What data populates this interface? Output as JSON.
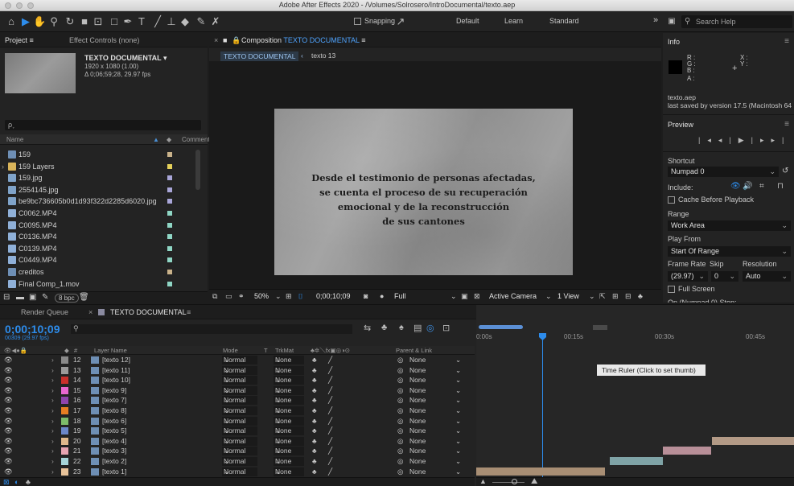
{
  "window": {
    "title": "Adobe After Effects 2020 - /Volumes/Solrosero/IntroDocumental/texto.aep"
  },
  "toolbar": {
    "snapping_label": "Snapping",
    "workspaces": [
      "Default",
      "Learn",
      "Standard"
    ],
    "more_label": "»",
    "search_placeholder": "Search Help"
  },
  "project": {
    "tab_project": "Project ≡",
    "tab_effects": "Effect Controls (none)",
    "comp_name": "TEXTO DOCUMENTAL ▾",
    "comp_res": "1920 x 1080 (1.00)",
    "comp_dur": "Δ 0;06;59;28, 29.97 fps",
    "search_glyph": "ρ˯",
    "col_name": "Name",
    "col_comment": "Comment",
    "items": [
      {
        "name": "159",
        "icon_color": "#6e8fb5",
        "label_color": "#c9b28a"
      },
      {
        "name": "159 Layers",
        "icon_color": "#d9b45a",
        "label_color": "#e5d15a"
      },
      {
        "name": "159.jpg",
        "icon_color": "#7fa3c9",
        "label_color": "#a9a6d8"
      },
      {
        "name": "2554145.jpg",
        "icon_color": "#7fa3c9",
        "label_color": "#a9a6d8"
      },
      {
        "name": "be9bc736605b0d1d93f322d2285d6020.jpg",
        "icon_color": "#7fa3c9",
        "label_color": "#a9a6d8"
      },
      {
        "name": "C0062.MP4",
        "icon_color": "#8fb0d8",
        "label_color": "#8fd6c5"
      },
      {
        "name": "C0095.MP4",
        "icon_color": "#8fb0d8",
        "label_color": "#8fd6c5"
      },
      {
        "name": "C0136.MP4",
        "icon_color": "#8fb0d8",
        "label_color": "#8fd6c5"
      },
      {
        "name": "C0139.MP4",
        "icon_color": "#8fb0d8",
        "label_color": "#8fd6c5"
      },
      {
        "name": "C0449.MP4",
        "icon_color": "#8fb0d8",
        "label_color": "#8fd6c5"
      },
      {
        "name": "creditos",
        "icon_color": "#6e8fb5",
        "label_color": "#c9b28a"
      },
      {
        "name": "Final Comp_1.mov",
        "icon_color": "#8fb0d8",
        "label_color": "#8fd6c5"
      }
    ],
    "bpc": "8 bpc"
  },
  "composition": {
    "tab_label": "Composition TEXTO DOCUMENTAL ≡",
    "tab_prefix": "Composition",
    "tab_name": "TEXTO DOCUMENTAL",
    "breadcrumb_comp": "TEXTO DOCUMENTAL",
    "breadcrumb_layer": "texto 13",
    "text_lines": [
      "Desde el testimonio de personas afectadas,",
      "se cuenta el proceso de su recuperación",
      "emocional y de la reconstrucción",
      "de sus cantones"
    ],
    "zoom": "50%",
    "timecode": "0;00;10;09",
    "resolution": "Full",
    "camera": "Active Camera",
    "views": "1 View"
  },
  "info": {
    "title": "Info",
    "r": "R :",
    "g": "G :",
    "b": "B :",
    "a": "A :",
    "x": "X :",
    "y": "Y :",
    "file": "texto.aep",
    "saved": "last saved by version 17.5 (Macintosh 64"
  },
  "preview": {
    "title": "Preview",
    "shortcut_label": "Shortcut",
    "shortcut_value": "Numpad 0",
    "include_label": "Include:",
    "cache_label": "Cache Before Playback",
    "range_label": "Range",
    "range_value": "Work Area",
    "playfrom_label": "Play From",
    "playfrom_value": "Start Of Range",
    "framerate_label": "Frame Rate",
    "skip_label": "Skip",
    "resolution_label": "Resolution",
    "framerate_value": "(29.97)",
    "skip_value": "0",
    "resolution_value": "Auto",
    "fullscreen_label": "Full Screen",
    "cutoff_label": "On (Numpad 0) Stop:"
  },
  "timeline": {
    "tab_render": "Render Queue",
    "tab_comp": "TEXTO DOCUMENTAL",
    "timecode": "0;00;10;09",
    "frames": "00309 (29.97 fps)",
    "col_layer": "Layer Name",
    "col_mode": "Mode",
    "col_t": "T",
    "col_trkmat": "TrkMat",
    "col_parent": "Parent & Link",
    "tick_0": "0:00s",
    "tick_15": "00:15s",
    "tick_30": "00:30s",
    "tick_45": "00:45s",
    "tooltip": "Time Ruler (Click to set thumb)",
    "playhead_fraction": 0.19,
    "layers": [
      {
        "num": "12",
        "name": "[texto 12]",
        "color": "#8a8a8a",
        "mode": "Normal",
        "trkmat": "None",
        "parent": "None"
      },
      {
        "num": "13",
        "name": "[texto 11]",
        "color": "#9a9a9a",
        "mode": "Normal",
        "trkmat": "None",
        "parent": "None"
      },
      {
        "num": "14",
        "name": "[texto 10]",
        "color": "#c9302c",
        "mode": "Normal",
        "trkmat": "None",
        "parent": "None"
      },
      {
        "num": "15",
        "name": "[texto 9]",
        "color": "#e867d0",
        "mode": "Normal",
        "trkmat": "None",
        "parent": "None"
      },
      {
        "num": "16",
        "name": "[texto 7]",
        "color": "#8e44ad",
        "mode": "Normal",
        "trkmat": "None",
        "parent": "None"
      },
      {
        "num": "17",
        "name": "[texto 8]",
        "color": "#e67e22",
        "mode": "Normal",
        "trkmat": "None",
        "parent": "None"
      },
      {
        "num": "18",
        "name": "[texto 6]",
        "color": "#7dbb6a",
        "mode": "Normal",
        "trkmat": "None",
        "parent": "None"
      },
      {
        "num": "19",
        "name": "[texto 5]",
        "color": "#6b87c9",
        "mode": "Normal",
        "trkmat": "None",
        "parent": "None"
      },
      {
        "num": "20",
        "name": "[texto 4]",
        "color": "#e0b98c",
        "mode": "Normal",
        "trkmat": "None",
        "parent": "None"
      },
      {
        "num": "21",
        "name": "[texto 3]",
        "color": "#e7a4b1",
        "mode": "Normal",
        "trkmat": "None",
        "parent": "None"
      },
      {
        "num": "22",
        "name": "[texto 2]",
        "color": "#a6d4d8",
        "mode": "Normal",
        "trkmat": "None",
        "parent": "None"
      },
      {
        "num": "23",
        "name": "[texto 1]",
        "color": "#e8c39a",
        "mode": "Normal",
        "trkmat": "None",
        "parent": "None"
      }
    ]
  },
  "colors": {
    "accent": "#2d8ceb",
    "panel_bg": "#232323",
    "toolbar_bg": "#232323"
  }
}
